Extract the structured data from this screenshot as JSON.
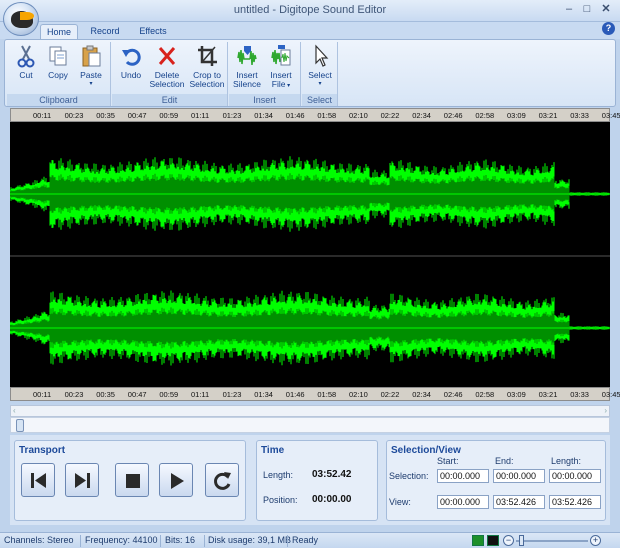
{
  "window": {
    "title": "untitled - Digitope Sound Editor",
    "minimize": "–",
    "maximize": "□",
    "close": "✕"
  },
  "tabs": [
    {
      "label": "Home",
      "active": true
    },
    {
      "label": "Record",
      "active": false
    },
    {
      "label": "Effects",
      "active": false
    }
  ],
  "help": "?",
  "ribbon": {
    "clipboard": {
      "label": "Clipboard",
      "cut": "Cut",
      "copy": "Copy",
      "paste": "Paste"
    },
    "edit": {
      "label": "Edit",
      "undo": "Undo",
      "delete_1": "Delete",
      "delete_2": "Selection",
      "crop_1": "Crop to",
      "crop_2": "Selection"
    },
    "insert": {
      "label": "Insert",
      "silence_1": "Insert",
      "silence_2": "Silence",
      "file_1": "Insert",
      "file_2": "File"
    },
    "select": {
      "label": "Select",
      "select": "Select"
    }
  },
  "ruler_ticks": [
    "00:11",
    "00:23",
    "00:35",
    "00:47",
    "00:59",
    "01:11",
    "01:23",
    "01:34",
    "01:46",
    "01:58",
    "02:10",
    "02:22",
    "02:34",
    "02:46",
    "02:58",
    "03:09",
    "03:21",
    "03:33",
    "03:45"
  ],
  "colors": {
    "wave_bright": "#00ff00",
    "wave_dark": "#008f00",
    "background": "#000000"
  },
  "transport": {
    "title": "Transport"
  },
  "time": {
    "title": "Time",
    "length_label": "Length:",
    "length_value": "03:52.42",
    "position_label": "Position:",
    "position_value": "00:00.00"
  },
  "selection_view": {
    "title": "Selection/View",
    "col_start": "Start:",
    "col_end": "End:",
    "col_length": "Length:",
    "row_selection": "Selection:",
    "row_view": "View:",
    "selection": {
      "start": "00:00.000",
      "end": "00:00.000",
      "length": "00:00.000"
    },
    "view": {
      "start": "00:00.000",
      "end": "03:52.426",
      "length": "03:52.426"
    }
  },
  "status": {
    "channels": "Channels: Stereo",
    "frequency": "Frequency: 44100",
    "bits": "Bits: 16",
    "disk": "Disk usage: 39,1 MB",
    "state": "Ready"
  }
}
